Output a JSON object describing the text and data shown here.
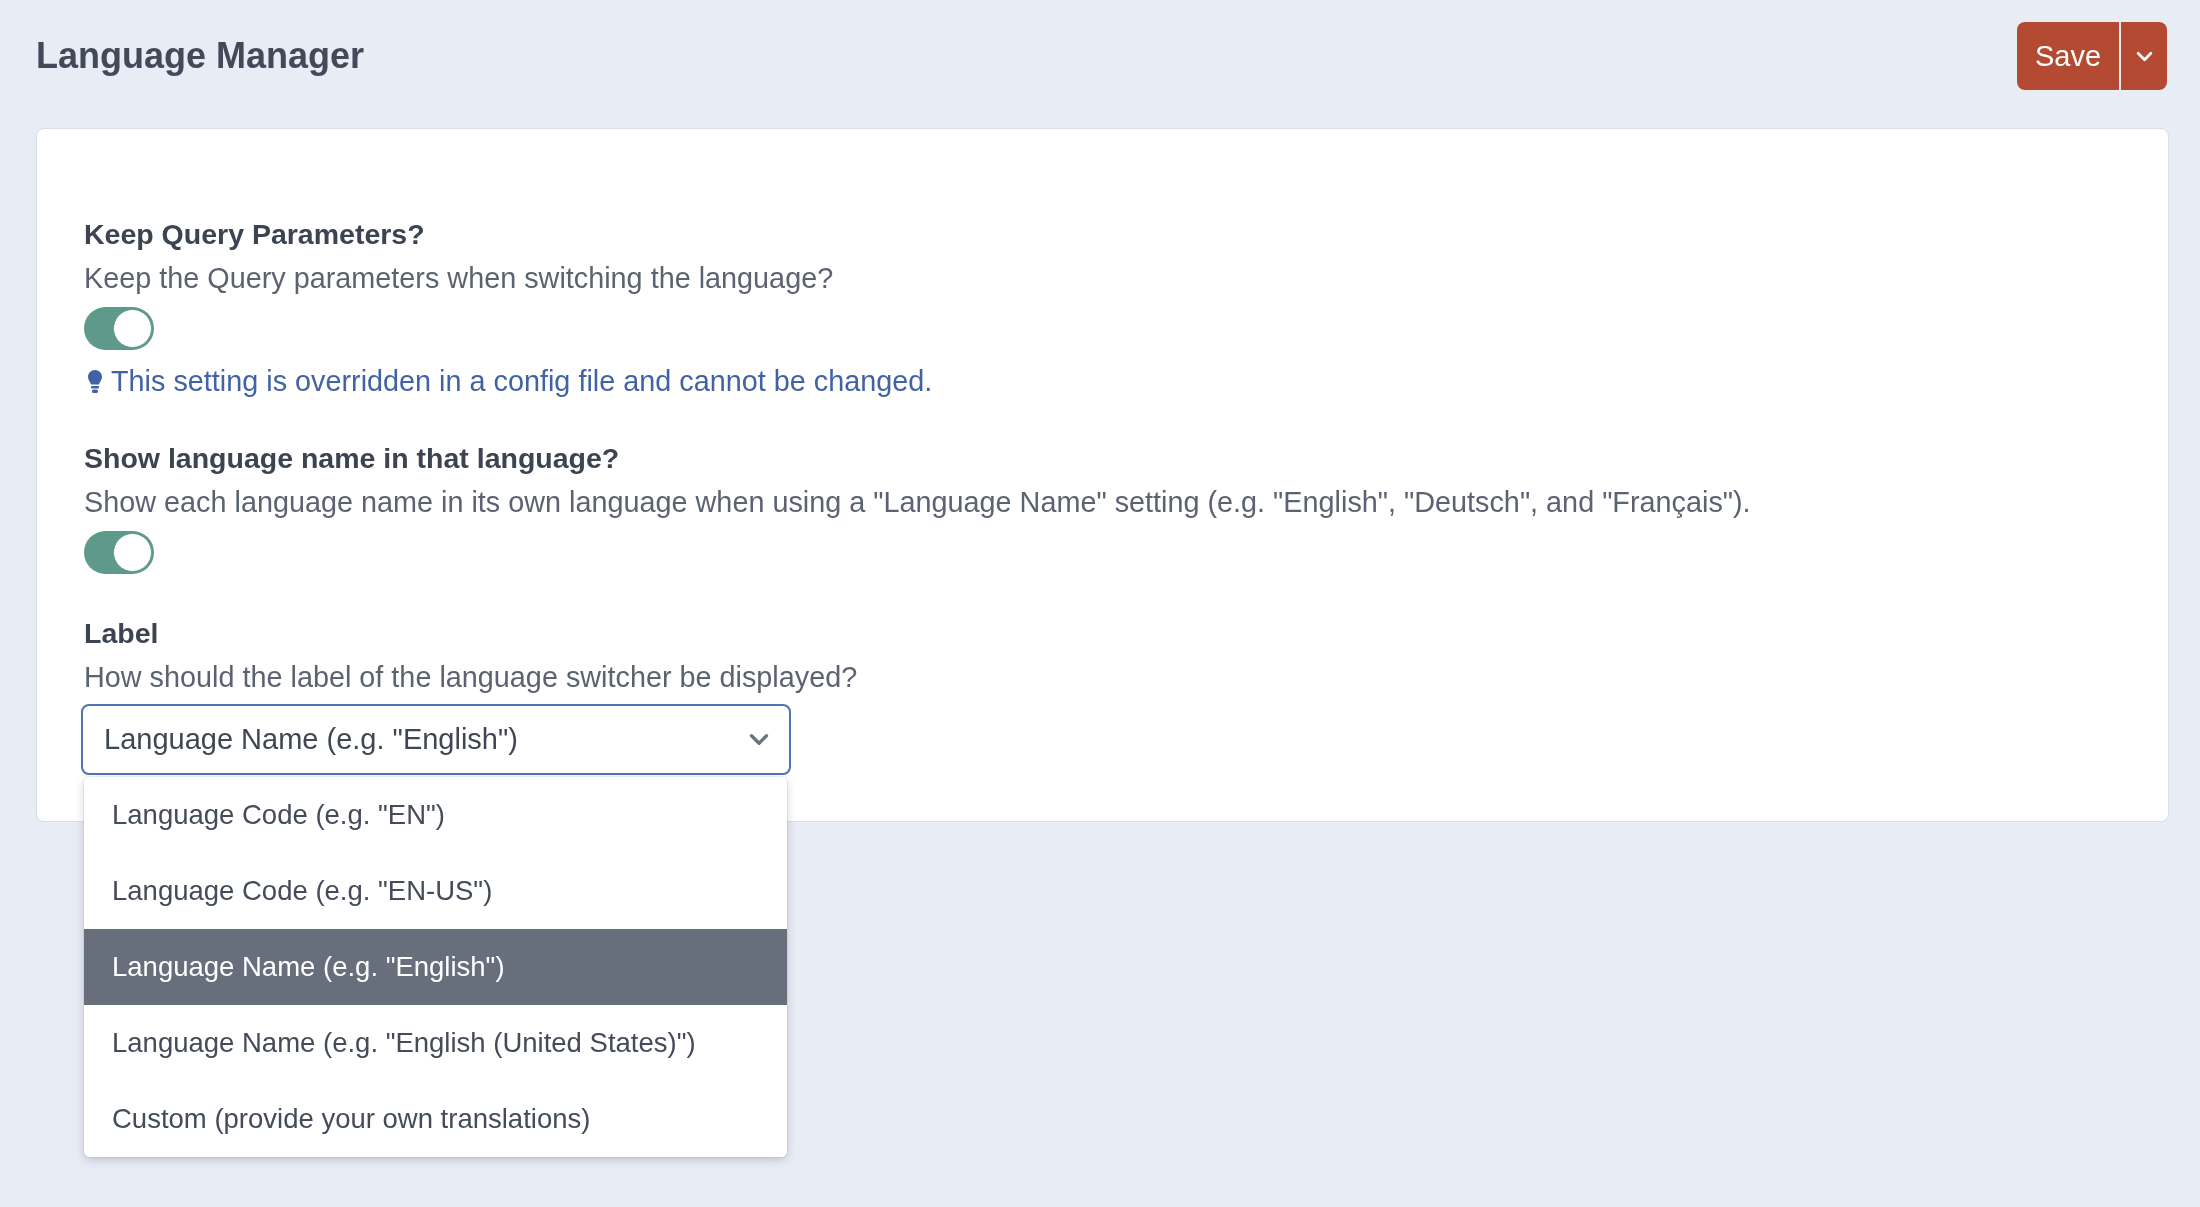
{
  "header": {
    "title": "Language Manager",
    "save_button": {
      "label": "Save"
    }
  },
  "settings": [
    {
      "kind": "toggle",
      "title": "Keep Query Parameters?",
      "description": "Keep the Query parameters when switching the language?",
      "on": true,
      "notice": "This setting is overridden in a config file and cannot be changed."
    },
    {
      "kind": "toggle",
      "title": "Show language name in that language?",
      "description": "Show each language name in its own language when using a \"Language Name\" setting (e.g. \"English\", \"Deutsch\", and \"Français\").",
      "on": true
    },
    {
      "kind": "select",
      "title": "Label",
      "description": "How should the label of the language switcher be displayed?",
      "value": "Language Name (e.g. \"English\")",
      "expanded": true,
      "options": [
        {
          "label": "Language Code (e.g. \"EN\")",
          "selected": false
        },
        {
          "label": "Language Code (e.g. \"EN-US\")",
          "selected": false
        },
        {
          "label": "Language Name (e.g. \"English\")",
          "selected": true
        },
        {
          "label": "Language Name (e.g. \"English (United States)\")",
          "selected": false
        },
        {
          "label": "Custom (provide your own translations)",
          "selected": false
        }
      ]
    }
  ]
}
